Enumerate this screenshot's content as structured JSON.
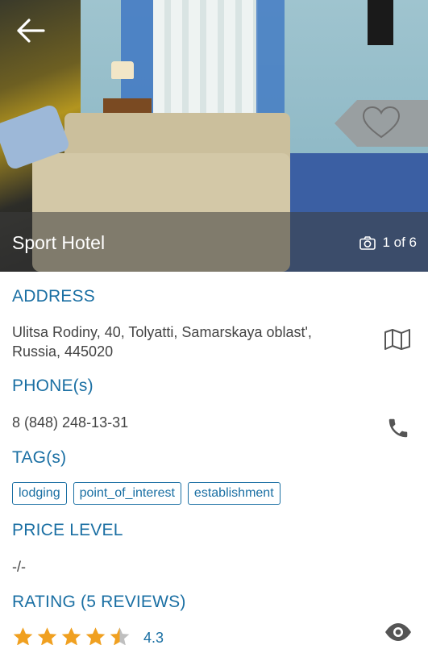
{
  "header": {
    "title": "Sport Hotel",
    "photo_counter": "1 of 6"
  },
  "address": {
    "heading": "ADDRESS",
    "line1": "Ulitsa Rodiny, 40, Tolyatti, Samarskaya oblast',",
    "line2": "Russia, 445020"
  },
  "phone": {
    "heading": "PHONE(s)",
    "number": "8 (848) 248-13-31"
  },
  "tags": {
    "heading": "TAG(s)",
    "items": [
      "lodging",
      "point_of_interest",
      "establishment"
    ]
  },
  "price": {
    "heading": "PRICE LEVEL",
    "value": "-/-"
  },
  "rating": {
    "heading": "RATING (5 REVIEWS)",
    "value": "4.3",
    "stars_filled_fraction": 0.86
  },
  "colors": {
    "accent": "#1a6fa3",
    "star": "#f0a020",
    "star_empty": "#bfbfbf"
  },
  "icons": {
    "back": "arrow-left-icon",
    "favorite": "heart-icon",
    "camera": "camera-icon",
    "map": "map-icon",
    "phone": "phone-icon",
    "view": "eye-icon"
  }
}
